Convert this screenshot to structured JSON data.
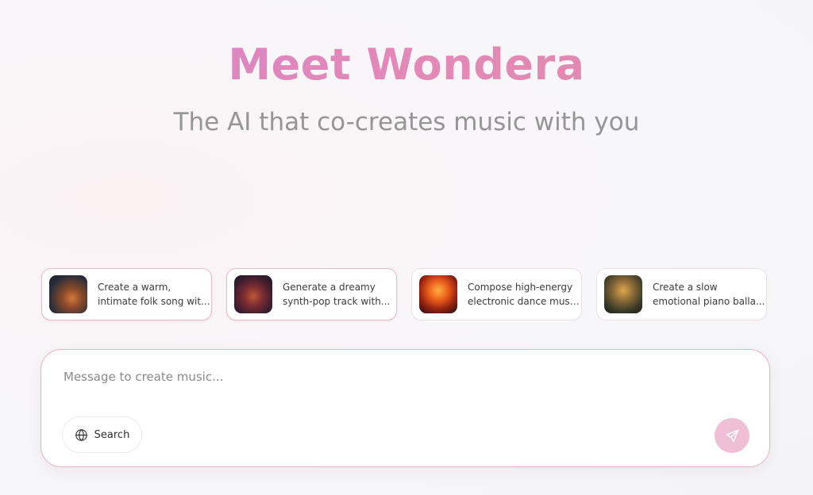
{
  "hero": {
    "title": "Meet Wondera",
    "subtitle": "The AI that co-creates music with you"
  },
  "suggestions": [
    {
      "line1": "Create a warm,",
      "line2": "intimate folk song wit...",
      "thumb_icon": "acoustic-guitar-photo"
    },
    {
      "line1": "Generate a dreamy",
      "line2": "synth-pop track with...",
      "thumb_icon": "neon-singer-photo"
    },
    {
      "line1": "Compose high-energy",
      "line2": "electronic dance musi...",
      "thumb_icon": "fiery-dj-stage-photo"
    },
    {
      "line1": "Create a slow",
      "line2": "emotional piano balla...",
      "thumb_icon": "tree-piano-silhouette-photo"
    }
  ],
  "composer": {
    "placeholder": "Message to create music...",
    "search_label": "Search",
    "search_icon": "globe-icon",
    "send_icon": "paper-plane-icon"
  },
  "colors": {
    "title_gradient_start": "#d782c8",
    "title_gradient_end": "#e08aa8",
    "subtitle": "#959595",
    "composer_border": "#e7b3c4",
    "send_button": "#efbfd6"
  }
}
